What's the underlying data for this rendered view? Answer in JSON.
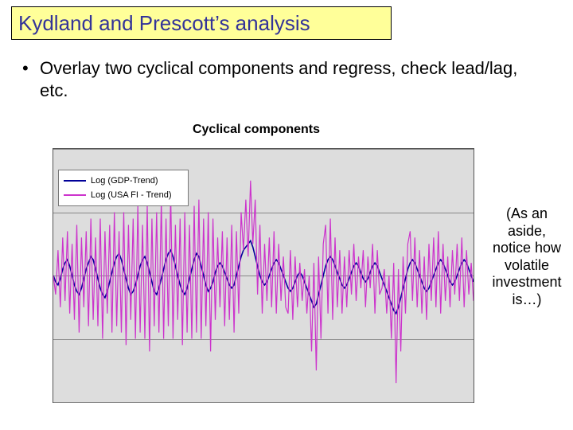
{
  "title": "Kydland and Prescott’s analysis",
  "bullet_text": "Overlay two cyclical components and regress, check lead/lag, etc.",
  "aside_text": "(As an aside, notice how volatile investment is…)",
  "legend": {
    "s1": "Log (GDP-Trend)",
    "s2": "Log (USA FI - Trend)"
  },
  "chart_data": {
    "type": "line",
    "title": "Cyclical components",
    "xlabel": "",
    "ylabel": "",
    "ylim": [
      -0.2,
      0.2
    ],
    "gridlines_y": [
      -0.2,
      -0.1,
      0,
      0.1,
      0.2
    ],
    "n_points": 180,
    "series": [
      {
        "name": "Log (GDP-Trend)",
        "color": "#000099",
        "values": [
          0.0,
          -0.01,
          -0.015,
          -0.005,
          0.01,
          0.02,
          0.025,
          0.015,
          0.0,
          -0.015,
          -0.025,
          -0.03,
          -0.02,
          -0.005,
          0.01,
          0.02,
          0.03,
          0.025,
          0.01,
          -0.005,
          -0.02,
          -0.03,
          -0.035,
          -0.025,
          -0.01,
          0.005,
          0.02,
          0.03,
          0.035,
          0.025,
          0.01,
          -0.005,
          -0.02,
          -0.03,
          -0.025,
          -0.015,
          0.0,
          0.015,
          0.025,
          0.03,
          0.02,
          0.005,
          -0.01,
          -0.025,
          -0.03,
          -0.02,
          -0.005,
          0.01,
          0.025,
          0.035,
          0.04,
          0.03,
          0.015,
          0.0,
          -0.015,
          -0.025,
          -0.03,
          -0.02,
          -0.005,
          0.01,
          0.025,
          0.035,
          0.03,
          0.015,
          0.0,
          -0.015,
          -0.025,
          -0.02,
          -0.01,
          0.005,
          0.015,
          0.02,
          0.015,
          0.005,
          -0.005,
          -0.015,
          -0.02,
          -0.015,
          0.0,
          0.015,
          0.03,
          0.04,
          0.045,
          0.05,
          0.055,
          0.045,
          0.03,
          0.015,
          0.0,
          -0.01,
          -0.015,
          -0.01,
          0.0,
          0.01,
          0.02,
          0.025,
          0.02,
          0.01,
          0.0,
          -0.01,
          -0.02,
          -0.025,
          -0.02,
          -0.01,
          0.0,
          0.005,
          0.0,
          -0.01,
          -0.02,
          -0.03,
          -0.04,
          -0.05,
          -0.045,
          -0.03,
          -0.015,
          0.0,
          0.015,
          0.025,
          0.03,
          0.025,
          0.015,
          0.005,
          -0.005,
          -0.015,
          -0.02,
          -0.015,
          -0.005,
          0.005,
          0.015,
          0.02,
          0.015,
          0.005,
          -0.005,
          -0.01,
          -0.005,
          0.005,
          0.015,
          0.02,
          0.015,
          0.005,
          -0.005,
          -0.015,
          -0.025,
          -0.035,
          -0.045,
          -0.055,
          -0.06,
          -0.05,
          -0.035,
          -0.02,
          -0.005,
          0.01,
          0.02,
          0.025,
          0.02,
          0.01,
          0.0,
          -0.01,
          -0.02,
          -0.025,
          -0.02,
          -0.01,
          0.0,
          0.01,
          0.02,
          0.025,
          0.02,
          0.01,
          0.0,
          -0.01,
          -0.015,
          -0.01,
          0.0,
          0.01,
          0.02,
          0.025,
          0.02,
          0.01,
          0.0,
          -0.01
        ]
      },
      {
        "name": "Log (USA FI - Trend)",
        "color": "#cc33cc",
        "values": [
          0.0,
          -0.03,
          0.04,
          -0.05,
          0.06,
          -0.04,
          0.07,
          -0.06,
          0.05,
          -0.07,
          0.08,
          -0.09,
          0.06,
          -0.05,
          0.07,
          -0.08,
          0.09,
          -0.07,
          0.06,
          -0.08,
          0.09,
          -0.1,
          0.07,
          -0.06,
          0.08,
          -0.09,
          0.1,
          -0.08,
          0.07,
          -0.09,
          0.1,
          -0.11,
          0.08,
          -0.07,
          0.09,
          -0.1,
          0.11,
          -0.09,
          0.08,
          -0.1,
          0.11,
          -0.12,
          0.09,
          -0.08,
          0.1,
          -0.09,
          0.12,
          -0.1,
          0.09,
          -0.08,
          0.13,
          -0.1,
          0.08,
          -0.07,
          0.09,
          -0.11,
          0.1,
          -0.09,
          0.08,
          -0.1,
          0.11,
          -0.09,
          0.12,
          -0.1,
          0.09,
          -0.08,
          0.1,
          -0.12,
          0.09,
          -0.07,
          0.06,
          -0.05,
          0.07,
          -0.08,
          0.06,
          -0.07,
          0.08,
          -0.09,
          0.07,
          -0.06,
          0.1,
          0.04,
          0.12,
          0.03,
          0.15,
          0.05,
          0.12,
          -0.03,
          0.08,
          -0.06,
          0.05,
          -0.04,
          0.06,
          -0.05,
          0.07,
          -0.06,
          0.05,
          -0.04,
          0.03,
          -0.05,
          -0.06,
          0.04,
          -0.07,
          0.03,
          -0.05,
          0.02,
          -0.04,
          0.01,
          -0.06,
          0.0,
          -0.12,
          0.02,
          -0.15,
          0.03,
          -0.1,
          0.05,
          0.08,
          -0.06,
          0.09,
          -0.07,
          0.06,
          -0.05,
          0.04,
          -0.06,
          0.03,
          -0.05,
          0.04,
          -0.03,
          0.05,
          -0.04,
          0.03,
          -0.02,
          0.04,
          -0.05,
          0.03,
          -0.02,
          0.05,
          -0.06,
          0.04,
          -0.03,
          -0.02,
          0.01,
          -0.06,
          0.0,
          -0.1,
          0.02,
          -0.17,
          0.01,
          -0.12,
          0.03,
          -0.06,
          0.05,
          0.07,
          -0.04,
          0.06,
          -0.05,
          0.04,
          -0.06,
          0.03,
          -0.07,
          0.05,
          -0.04,
          0.06,
          -0.05,
          0.07,
          -0.06,
          0.05,
          -0.04,
          0.03,
          -0.05,
          0.04,
          -0.03,
          0.05,
          -0.04,
          0.06,
          -0.05,
          0.04,
          -0.03,
          0.02,
          -0.04
        ]
      }
    ]
  }
}
